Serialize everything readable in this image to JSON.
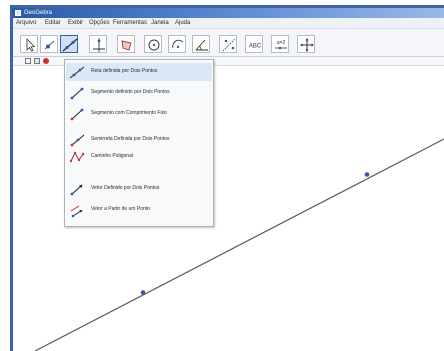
{
  "window": {
    "title": "GeoGebra"
  },
  "menu": {
    "items": [
      "Arquivo",
      "Editar",
      "Exibir",
      "Opções",
      "Ferramentas",
      "Janela",
      "Ajuda"
    ]
  },
  "toolbar": {
    "tools": [
      {
        "icon": "move-arrow-icon"
      },
      {
        "icon": "point-icon"
      },
      {
        "icon": "line-two-points-icon",
        "active": true
      },
      {
        "icon": "perpendicular-line-icon"
      },
      {
        "icon": "polygon-icon"
      },
      {
        "icon": "circle-icon"
      },
      {
        "icon": "circle-arc-icon"
      },
      {
        "icon": "angle-icon"
      },
      {
        "icon": "reflect-icon"
      },
      {
        "icon": "text-abc-icon",
        "text": "ABC"
      },
      {
        "icon": "slider-icon",
        "text": "a=2"
      },
      {
        "icon": "move-graphics-icon"
      }
    ]
  },
  "tool_menu": {
    "items": [
      {
        "label": "Reta definida por Dois Pontos",
        "icon": "line-two-points-icon"
      },
      {
        "label": "Segmento definido por Dois Pontos",
        "icon": "segment-two-points-icon"
      },
      {
        "label": "Segmento com Comprimento Fixo",
        "icon": "segment-fixed-length-icon"
      },
      {
        "label": "Semirreta Definida por Dois Pontos",
        "icon": "ray-two-points-icon"
      },
      {
        "label": "Caminho Poligonal",
        "icon": "polyline-icon"
      },
      {
        "label": "Vetor Definido por Dois Pontos",
        "icon": "vector-two-points-icon"
      },
      {
        "label": "Vetor a Partir de um Ponto",
        "icon": "vector-from-point-icon"
      }
    ]
  },
  "colors": {
    "window_frame": "#3d62a8",
    "line": "#5a5a5a",
    "point": "#3a56b0",
    "highlight": "#dde8f7"
  }
}
